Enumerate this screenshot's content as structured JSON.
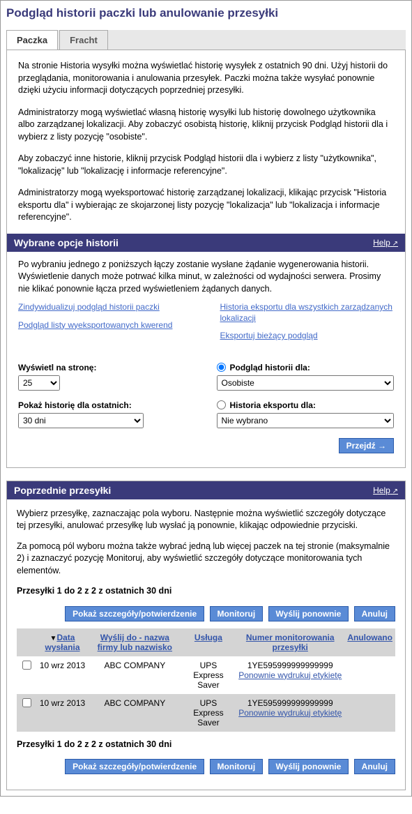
{
  "page_title": "Podgląd historii paczki lub anulowanie przesyłki",
  "tabs": {
    "paczka": "Paczka",
    "fracht": "Fracht"
  },
  "intro": {
    "p1": "Na stronie Historia wysyłki można wyświetlać historię wysyłek z ostatnich 90 dni. Użyj historii do przeglądania, monitorowania i anulowania przesyłek. Paczki można także wysyłać ponownie dzięki użyciu informacji dotyczących poprzedniej przesyłki.",
    "p2": "Administratorzy mogą wyświetlać własną historię wysyłki lub historię dowolnego użytkownika albo zarządzanej lokalizacji. Aby zobaczyć osobistą historię, kliknij przycisk Podgląd historii dla i wybierz z listy pozycję \"osobiste\".",
    "p3": "Aby zobaczyć inne historie, kliknij przycisk Podgląd historii dla i wybierz z listy \"użytkownika\", \"lokalizację\" lub \"lokalizację i informacje referencyjne\".",
    "p4": "Administratorzy mogą wyeksportować historię zarządzanej lokalizacji, klikając przycisk \"Historia eksportu dla\" i wybierając ze skojarzonej listy pozycję \"lokalizacja\" lub \"lokalizacja i informacje referencyjne\"."
  },
  "history_options": {
    "header": "Wybrane opcje historii",
    "help": "Help",
    "note": "Po wybraniu jednego z poniższych łączy zostanie wysłane żądanie wygenerowania historii. Wyświetlenie danych może potrwać kilka minut, w zależności od wydajności serwera. Prosimy nie klikać ponownie łącza przed wyświetleniem żądanych danych.",
    "links": {
      "customize": "Zindywidualizuj podgląd historii paczki",
      "exported_queries": "Podgląd listy wyeksportowanych kwerend",
      "export_all": "Historia eksportu dla wszystkich zarządzanych lokalizacji",
      "export_current": "Eksportuj bieżący podgląd"
    },
    "display_per_page_label": "Wyświetl na stronę:",
    "display_per_page_value": "25",
    "show_history_label": "Pokaż historię dla ostatnich:",
    "show_history_value": "30 dni",
    "view_history_for_label": "Podgląd historii dla:",
    "view_history_for_value": "Osobiste",
    "export_history_for_label": "Historia eksportu dla:",
    "export_history_for_value": "Nie wybrano",
    "go_button": "Przejdź"
  },
  "prev_shipments": {
    "header": "Poprzednie przesyłki",
    "help": "Help",
    "p1": "Wybierz przesyłkę, zaznaczając pola wyboru. Następnie można wyświetlić szczegóły dotyczące tej przesyłki, anulować przesyłkę lub wysłać ją ponownie, klikając odpowiednie przyciski.",
    "p2": "Za pomocą pól wyboru można także wybrać jedną lub więcej paczek na tej stronie (maksymalnie 2) i zaznaczyć pozycję Monitoruj, aby wyświetlić szczegóły dotyczące monitorowania tych elementów.",
    "count_line": "Przesyłki 1 do 2 z 2 z ostatnich 30 dni",
    "buttons": {
      "details": "Pokaż szczegóły/potwierdzenie",
      "track": "Monitoruj",
      "resend": "Wyślij ponownie",
      "cancel": "Anuluj"
    },
    "columns": {
      "date": "Data wysłania",
      "shipto": "Wyślij do - nazwa firmy lub nazwisko",
      "service": "Usługa",
      "tracking": "Numer monitorowania przesyłki",
      "cancelled": "Anulowano"
    },
    "rows": [
      {
        "date": "10 wrz 2013",
        "shipto": "ABC COMPANY",
        "service": "UPS Express Saver",
        "tracking": "1YE595999999999999",
        "reprint": "Ponownie wydrukuj etykietę"
      },
      {
        "date": "10 wrz 2013",
        "shipto": "ABC COMPANY",
        "service": "UPS Express Saver",
        "tracking": "1YE595999999999999",
        "reprint": "Ponownie wydrukuj etykietę"
      }
    ]
  }
}
